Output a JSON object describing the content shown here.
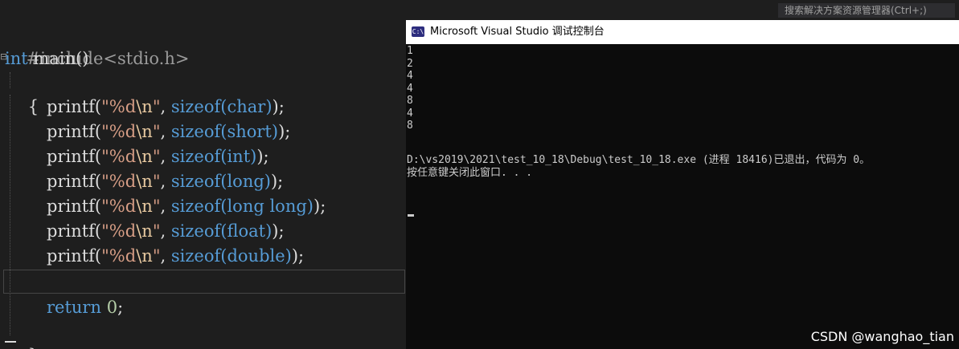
{
  "editor": {
    "lines": {
      "include": "#include<stdio.h>",
      "main_kw": "int",
      "main_rest": " main()",
      "open_brace": "{",
      "close_brace": "}",
      "return_kw": "return",
      "return_num": "0",
      "return_semi": ";"
    },
    "printf": {
      "fn": "printf(",
      "fmt_open": "\"%d",
      "fmt_esc": "\\n",
      "fmt_close": "\"",
      "comma": ", ",
      "sizeof_kw": "sizeof",
      "close": ");"
    },
    "types": [
      "char",
      "short",
      "int",
      "long",
      "long long",
      "float",
      "double"
    ]
  },
  "search": {
    "hint": "搜索解决方案资源管理器(Ctrl+;)"
  },
  "console": {
    "icon_label": "C:\\",
    "title": "Microsoft Visual Studio 调试控制台",
    "outputs": [
      "1",
      "2",
      "4",
      "4",
      "8",
      "4",
      "8"
    ],
    "exit_message": "D:\\vs2019\\2021\\test_10_18\\Debug\\test_10_18.exe (进程 18416)已退出，代码为 0。",
    "press_key": "按任意键关闭此窗口. . ."
  },
  "watermark": "CSDN @wanghao_tian"
}
